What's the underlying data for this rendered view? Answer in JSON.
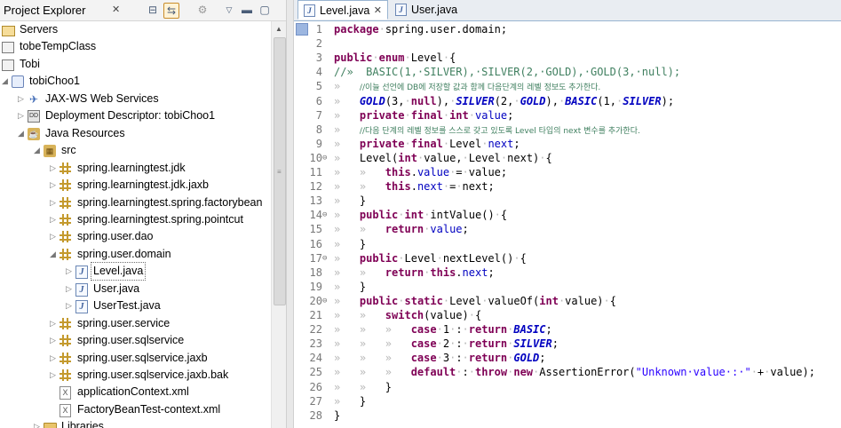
{
  "explorer": {
    "title": "Project Explorer",
    "tree": [
      {
        "label": "Servers",
        "icon": "folder-open-icon",
        "indent": 0,
        "twisty": ""
      },
      {
        "label": "tobeTempClass",
        "icon": "project-icon",
        "indent": 0,
        "twisty": ""
      },
      {
        "label": "Tobi",
        "icon": "project-icon",
        "indent": 0,
        "twisty": ""
      },
      {
        "label": "tobiChoo1",
        "icon": "web-project-icon",
        "indent": 0,
        "twisty": "◢"
      },
      {
        "label": "JAX-WS Web Services",
        "icon": "web-services-icon",
        "indent": 1,
        "twisty": "▷"
      },
      {
        "label": "Deployment Descriptor: tobiChoo1",
        "icon": "deployment-descriptor-icon",
        "indent": 1,
        "twisty": "▷"
      },
      {
        "label": "Java Resources",
        "icon": "java-resources-icon",
        "indent": 1,
        "twisty": "◢"
      },
      {
        "label": "src",
        "icon": "source-folder-icon",
        "indent": 2,
        "twisty": "◢"
      },
      {
        "label": "spring.learningtest.jdk",
        "icon": "package-icon",
        "indent": 3,
        "twisty": "▷"
      },
      {
        "label": "spring.learningtest.jdk.jaxb",
        "icon": "package-icon",
        "indent": 3,
        "twisty": "▷"
      },
      {
        "label": "spring.learningtest.spring.factorybean",
        "icon": "package-icon",
        "indent": 3,
        "twisty": "▷"
      },
      {
        "label": "spring.learningtest.spring.pointcut",
        "icon": "package-icon",
        "indent": 3,
        "twisty": "▷"
      },
      {
        "label": "spring.user.dao",
        "icon": "package-icon",
        "indent": 3,
        "twisty": "▷"
      },
      {
        "label": "spring.user.domain",
        "icon": "package-icon",
        "indent": 3,
        "twisty": "◢"
      },
      {
        "label": "Level.java",
        "icon": "java-file-icon",
        "indent": 4,
        "twisty": "▷",
        "selected": true
      },
      {
        "label": "User.java",
        "icon": "java-file-icon",
        "indent": 4,
        "twisty": "▷"
      },
      {
        "label": "UserTest.java",
        "icon": "java-file-icon",
        "indent": 4,
        "twisty": "▷"
      },
      {
        "label": "spring.user.service",
        "icon": "package-icon",
        "indent": 3,
        "twisty": "▷"
      },
      {
        "label": "spring.user.sqlservice",
        "icon": "package-icon",
        "indent": 3,
        "twisty": "▷"
      },
      {
        "label": "spring.user.sqlservice.jaxb",
        "icon": "package-icon",
        "indent": 3,
        "twisty": "▷"
      },
      {
        "label": "spring.user.sqlservice.jaxb.bak",
        "icon": "package-icon",
        "indent": 3,
        "twisty": "▷"
      },
      {
        "label": "applicationContext.xml",
        "icon": "xml-file-icon",
        "indent": 3,
        "twisty": ""
      },
      {
        "label": "FactoryBeanTest-context.xml",
        "icon": "xml-file-icon",
        "indent": 3,
        "twisty": ""
      },
      {
        "label": "Libraries",
        "icon": "library-icon",
        "indent": 2,
        "twisty": "▷"
      }
    ]
  },
  "editor": {
    "tabs": [
      {
        "label": "Level.java",
        "active": true
      },
      {
        "label": "User.java",
        "active": false
      }
    ],
    "lines": [
      {
        "n": "1",
        "fold": "",
        "html": "<span class=\"kw\">package</span><span class=\"ws\">·</span>spring.user.domain;"
      },
      {
        "n": "2",
        "fold": "",
        "html": ""
      },
      {
        "n": "3",
        "fold": "",
        "html": "<span class=\"kw\">public</span><span class=\"ws\">·</span><span class=\"kw\">enum</span><span class=\"ws\">·</span>Level<span class=\"ws\">·</span>{"
      },
      {
        "n": "4",
        "fold": "",
        "html": "<span class=\"cm\" style=\"font-family:'DejaVu Sans Mono',monospace;font-size:12px\">//»  BASIC(1,·SILVER),·SILVER(2,·GOLD),·GOLD(3,·null);</span>"
      },
      {
        "n": "5",
        "fold": "",
        "html": "<span class=\"ws\">»   </span><span class=\"cm\">//이늘 선언에 DB에 저장할 값과 함께 다음단계의 레벨 정보도 추가한다.</span>"
      },
      {
        "n": "6",
        "fold": "",
        "html": "<span class=\"ws\">»   </span><span class=\"st\">GOLD</span>(3,<span class=\"ws\">·</span><span class=\"kw\">null</span>),<span class=\"ws\">·</span><span class=\"st\">SILVER</span>(2,<span class=\"ws\">·</span><span class=\"st\">GOLD</span>),<span class=\"ws\">·</span><span class=\"st\">BASIC</span>(1,<span class=\"ws\">·</span><span class=\"st\">SILVER</span>);"
      },
      {
        "n": "7",
        "fold": "",
        "html": "<span class=\"ws\">»   </span><span class=\"kw\">private</span><span class=\"ws\">·</span><span class=\"kw\">final</span><span class=\"ws\">·</span><span class=\"kw\">int</span><span class=\"ws\">·</span><span class=\"fld\">value</span>;"
      },
      {
        "n": "8",
        "fold": "",
        "html": "<span class=\"ws\">»   </span><span class=\"cm\">//다음 단계의 레벨 정보를 스스로 갖고 있도록 Level 타입의 next 변수를 추가한다.</span>"
      },
      {
        "n": "9",
        "fold": "",
        "html": "<span class=\"ws\">»   </span><span class=\"kw\">private</span><span class=\"ws\">·</span><span class=\"kw\">final</span><span class=\"ws\">·</span>Level<span class=\"ws\">·</span><span class=\"fld\">next</span>;"
      },
      {
        "n": "10",
        "fold": "⊖",
        "html": "<span class=\"ws\">»   </span>Level(<span class=\"kw\">int</span><span class=\"ws\">·</span>value,<span class=\"ws\">·</span>Level<span class=\"ws\">·</span>next)<span class=\"ws\">·</span>{"
      },
      {
        "n": "11",
        "fold": "",
        "html": "<span class=\"ws\">»   »   </span><span class=\"kw\">this</span>.<span class=\"fld\">value</span><span class=\"ws\">·</span>=<span class=\"ws\">·</span>value;"
      },
      {
        "n": "12",
        "fold": "",
        "html": "<span class=\"ws\">»   »   </span><span class=\"kw\">this</span>.<span class=\"fld\">next</span><span class=\"ws\">·</span>=<span class=\"ws\">·</span>next;"
      },
      {
        "n": "13",
        "fold": "",
        "html": "<span class=\"ws\">»   </span>}"
      },
      {
        "n": "14",
        "fold": "⊖",
        "html": "<span class=\"ws\">»   </span><span class=\"kw\">public</span><span class=\"ws\">·</span><span class=\"kw\">int</span><span class=\"ws\">·</span>intValue()<span class=\"ws\">·</span>{"
      },
      {
        "n": "15",
        "fold": "",
        "html": "<span class=\"ws\">»   »   </span><span class=\"kw\">return</span><span class=\"ws\">·</span><span class=\"fld\">value</span>;"
      },
      {
        "n": "16",
        "fold": "",
        "html": "<span class=\"ws\">»   </span>}"
      },
      {
        "n": "17",
        "fold": "⊖",
        "html": "<span class=\"ws\">»   </span><span class=\"kw\">public</span><span class=\"ws\">·</span>Level<span class=\"ws\">·</span>nextLevel()<span class=\"ws\">·</span>{"
      },
      {
        "n": "18",
        "fold": "",
        "html": "<span class=\"ws\">»   »   </span><span class=\"kw\">return</span><span class=\"ws\">·</span><span class=\"kw\">this</span>.<span class=\"fld\">next</span>;"
      },
      {
        "n": "19",
        "fold": "",
        "html": "<span class=\"ws\">»   </span>}"
      },
      {
        "n": "20",
        "fold": "⊖",
        "html": "<span class=\"ws\">»   </span><span class=\"kw\">public</span><span class=\"ws\">·</span><span class=\"kw\">static</span><span class=\"ws\">·</span>Level<span class=\"ws\">·</span>valueOf(<span class=\"kw\">int</span><span class=\"ws\">·</span>value)<span class=\"ws\">·</span>{"
      },
      {
        "n": "21",
        "fold": "",
        "html": "<span class=\"ws\">»   »   </span><span class=\"kw\">switch</span>(value)<span class=\"ws\">·</span>{"
      },
      {
        "n": "22",
        "fold": "",
        "html": "<span class=\"ws\">»   »   »   </span><span class=\"kw\">case</span><span class=\"ws\">·</span>1<span class=\"ws\">·</span>:<span class=\"ws\">·</span><span class=\"kw\">return</span><span class=\"ws\">·</span><span class=\"st\">BASIC</span>;"
      },
      {
        "n": "23",
        "fold": "",
        "html": "<span class=\"ws\">»   »   »   </span><span class=\"kw\">case</span><span class=\"ws\">·</span>2<span class=\"ws\">·</span>:<span class=\"ws\">·</span><span class=\"kw\">return</span><span class=\"ws\">·</span><span class=\"st\">SILVER</span>;"
      },
      {
        "n": "24",
        "fold": "",
        "html": "<span class=\"ws\">»   »   »   </span><span class=\"kw\">case</span><span class=\"ws\">·</span>3<span class=\"ws\">·</span>:<span class=\"ws\">·</span><span class=\"kw\">return</span><span class=\"ws\">·</span><span class=\"st\">GOLD</span>;"
      },
      {
        "n": "25",
        "fold": "",
        "html": "<span class=\"ws\">»   »   »   </span><span class=\"kw\">default</span><span class=\"ws\">·</span>:<span class=\"ws\">·</span><span class=\"kw\">throw</span><span class=\"ws\">·</span><span class=\"kw\">new</span><span class=\"ws\">·</span>AssertionError(<span class=\"str\">\"Unknown·value·:·\"</span><span class=\"ws\">·</span>+<span class=\"ws\">·</span>value);"
      },
      {
        "n": "26",
        "fold": "",
        "html": "<span class=\"ws\">»   »   </span>}"
      },
      {
        "n": "27",
        "fold": "",
        "html": "<span class=\"ws\">»   </span>}"
      },
      {
        "n": "28",
        "fold": "",
        "html": "}"
      }
    ]
  }
}
